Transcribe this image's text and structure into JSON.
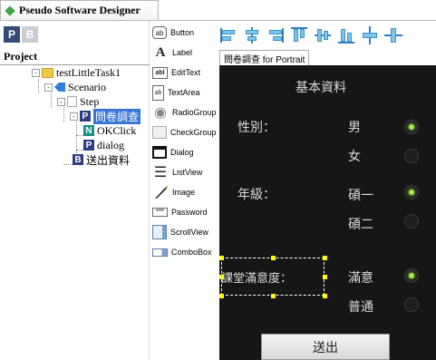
{
  "app": {
    "title": "Pseudo Software Designer"
  },
  "project_panel": {
    "buttons": [
      {
        "label": "P"
      },
      {
        "label": "B"
      }
    ],
    "title": "Project",
    "tree": [
      {
        "label": "testLittleTask1",
        "icon": "folder-icon",
        "expander": "-"
      },
      {
        "label": "Scenario",
        "icon": "scenario-icon",
        "expander": "-"
      },
      {
        "label": "Step",
        "icon": "step-icon",
        "expander": "-"
      },
      {
        "label": "問卷調查",
        "icon": "letter-p-icon",
        "icon_text": "P",
        "expander": "-",
        "selected": true
      },
      {
        "label": "OKClick",
        "icon": "letter-n-icon",
        "icon_text": "N"
      },
      {
        "label": "dialog",
        "icon": "letter-p-icon",
        "icon_text": "P"
      },
      {
        "label": "送出資料",
        "icon": "letter-b-icon",
        "icon_text": "B"
      }
    ]
  },
  "palette": {
    "items": [
      {
        "label": "Button",
        "icon": "button-icon",
        "glyph": "ab"
      },
      {
        "label": "Label",
        "icon": "label-icon",
        "glyph": "A"
      },
      {
        "label": "EditText",
        "icon": "edittext-icon",
        "glyph": "abl"
      },
      {
        "label": "TextArea",
        "icon": "textarea-icon",
        "glyph": "ab"
      },
      {
        "label": "RadioGroup",
        "icon": "radiogroup-icon",
        "glyph": "◉"
      },
      {
        "label": "CheckGroup",
        "icon": "checkgroup-icon",
        "glyph": ""
      },
      {
        "label": "Dialog",
        "icon": "dialog-icon",
        "glyph": ""
      },
      {
        "label": "ListView",
        "icon": "listview-icon",
        "glyph": "☰"
      },
      {
        "label": "Image",
        "icon": "image-icon",
        "glyph": ""
      },
      {
        "label": "Password",
        "icon": "password-icon",
        "glyph": "***"
      },
      {
        "label": "ScrollView",
        "icon": "scrollview-icon",
        "glyph": ""
      },
      {
        "label": "ComboBox",
        "icon": "combobox-icon",
        "glyph": ""
      }
    ]
  },
  "designer": {
    "tab_label": "問卷調查 for Portrait",
    "form": {
      "heading": "基本資料",
      "groups": [
        {
          "label": "性別：",
          "options": [
            {
              "text": "男",
              "checked": true
            },
            {
              "text": "女",
              "checked": false
            }
          ]
        },
        {
          "label": "年級：",
          "options": [
            {
              "text": "碩一",
              "checked": true
            },
            {
              "text": "碩二",
              "checked": false
            }
          ]
        },
        {
          "label": "課堂滿意度：",
          "options": [
            {
              "text": "滿意",
              "checked": true
            },
            {
              "text": "普通",
              "checked": false
            }
          ]
        }
      ],
      "submit_label": "送出"
    }
  },
  "colors": {
    "accent": "#3875d7",
    "canvas": "#161616",
    "radio_on": "#9ef040",
    "handle": "#ffff00"
  }
}
